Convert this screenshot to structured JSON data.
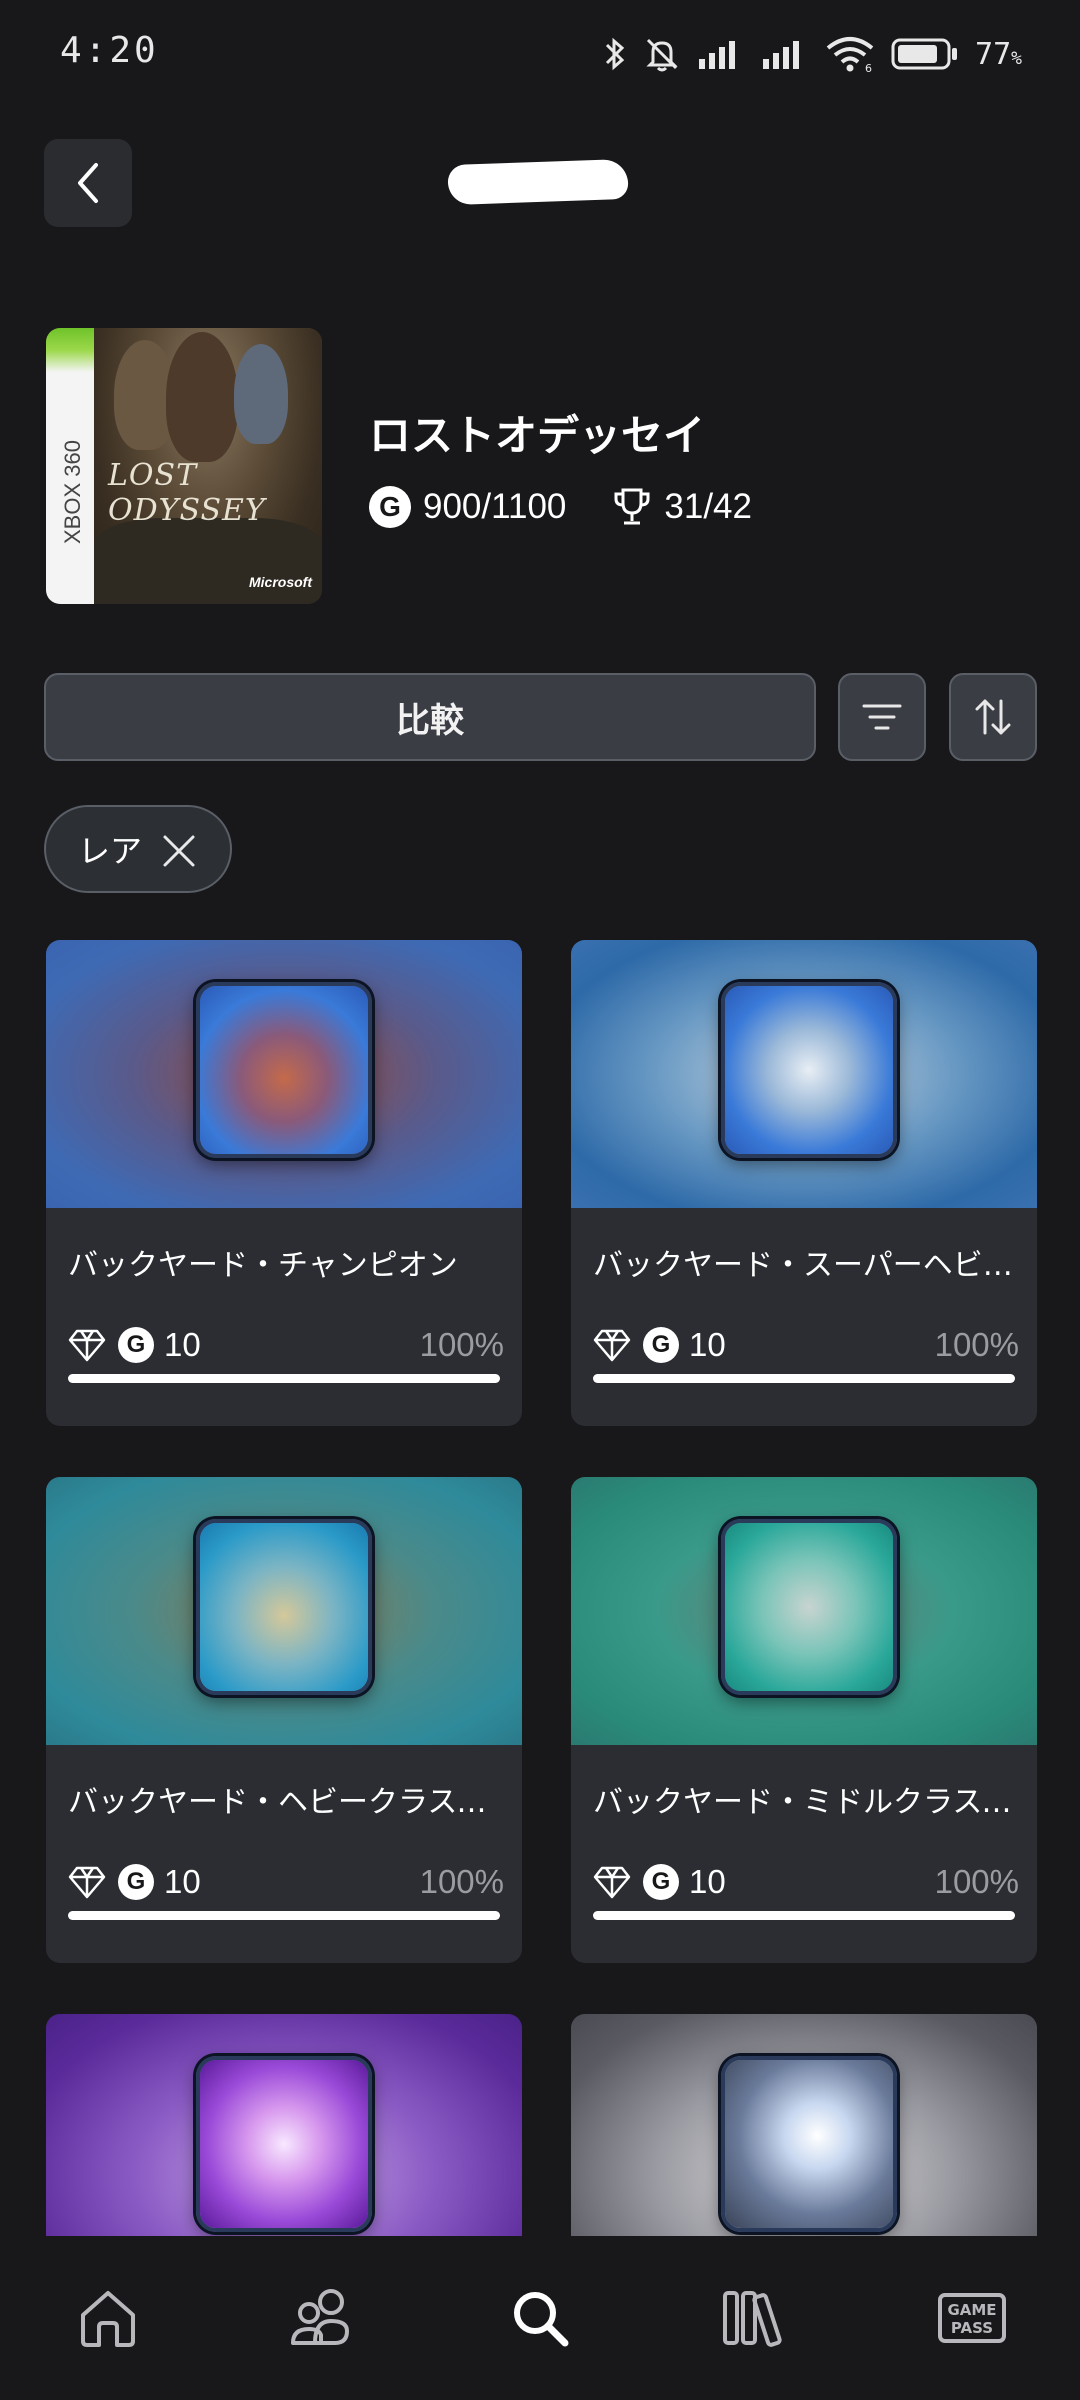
{
  "status_bar": {
    "time": "4:20",
    "battery": "77",
    "battery_unit": "%",
    "icons": [
      "bluetooth-icon",
      "mute-bell-icon",
      "signal-icon",
      "signal-icon",
      "wifi-icon",
      "battery-icon"
    ]
  },
  "header": {
    "back_icon": "chevron-left-icon"
  },
  "game": {
    "title": "ロストオデッセイ",
    "cover_platform": "XBOX 360",
    "cover_logo": "LOST ODYSSEY",
    "cover_publisher": "Microsoft",
    "gamerscore": "900/1100",
    "achievements": "31/42"
  },
  "controls": {
    "compare_label": "比較",
    "filter_icon": "filter-icon",
    "sort_icon": "sort-icon"
  },
  "filter_chip": {
    "label": "レア"
  },
  "achievements": [
    {
      "name": "バックヤード・チャンピオン",
      "score": "10",
      "percent": "100%",
      "progress": 1.0
    },
    {
      "name": "バックヤード・スーパーヘビークラス…",
      "score": "10",
      "percent": "100%",
      "progress": 1.0
    },
    {
      "name": "バックヤード・ヘビークラスマスター",
      "score": "10",
      "percent": "100%",
      "progress": 1.0
    },
    {
      "name": "バックヤード・ミドルクラスマスター",
      "score": "10",
      "percent": "100%",
      "progress": 1.0
    },
    {
      "name": "",
      "score": "",
      "percent": "",
      "progress": null
    },
    {
      "name": "",
      "score": "",
      "percent": "",
      "progress": null
    }
  ],
  "bottom_nav": [
    "home-icon",
    "friends-icon",
    "search-icon",
    "library-icon",
    "game-pass-icon"
  ],
  "bottom_nav_labels": {
    "game_pass": "GAME PASS"
  },
  "colors": {
    "background": "#18181a",
    "card": "#2b2d32",
    "button": "#3a3d44",
    "muted_text": "#9a9ca0"
  }
}
